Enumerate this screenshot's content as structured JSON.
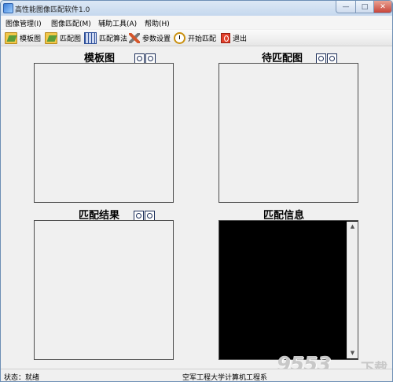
{
  "window": {
    "title": "高性能图像匹配软件1.0",
    "controls": {
      "minimize": "—",
      "maximize": "□",
      "close": "✕"
    }
  },
  "menu": [
    "图像管理(I)",
    "图像匹配(M)",
    "辅助工具(A)",
    "帮助(H)"
  ],
  "toolbar": [
    {
      "label": "模板图",
      "icon": "open-folder-icon"
    },
    {
      "label": "匹配图",
      "icon": "open-folder-icon"
    },
    {
      "label": "匹配算法",
      "icon": "grid-icon"
    },
    {
      "label": "参数设置",
      "icon": "tools-icon"
    },
    {
      "label": "开始匹配",
      "icon": "clock-icon"
    },
    {
      "label": "退出",
      "icon": "exit-icon"
    }
  ],
  "panels": {
    "template": {
      "title": "模板图"
    },
    "match": {
      "title": "待匹配图"
    },
    "result": {
      "title": "匹配结果"
    },
    "info": {
      "title": "匹配信息"
    }
  },
  "status": {
    "left": "状态：就绪",
    "right": "空军工程大学计算机工程系"
  },
  "watermark": {
    "number": "9553",
    "text": "下载"
  }
}
